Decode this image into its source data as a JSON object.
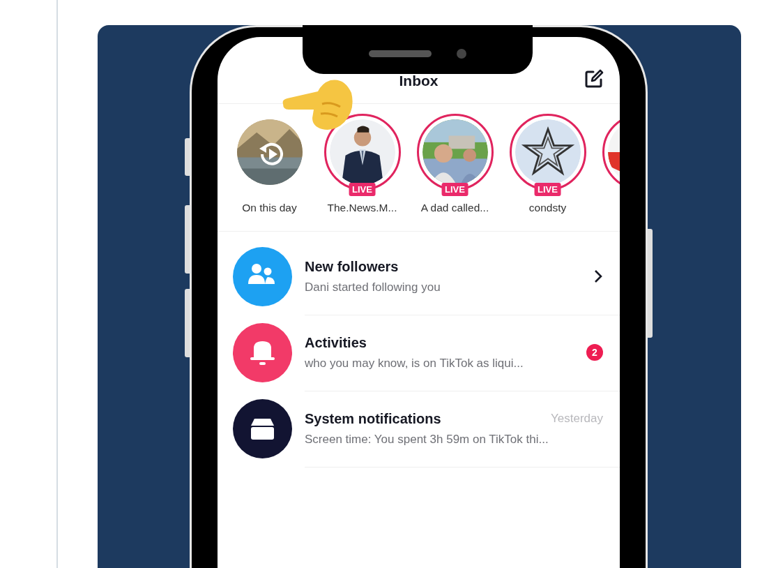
{
  "header": {
    "title": "Inbox"
  },
  "stories": [
    {
      "label": "On this day",
      "ring": false,
      "kind": "memory"
    },
    {
      "label": "The.News.M...",
      "ring": true,
      "badge": "LIVE",
      "kind": "person"
    },
    {
      "label": "A dad called...",
      "ring": true,
      "badge": "LIVE",
      "kind": "outdoor"
    },
    {
      "label": "condsty",
      "ring": true,
      "badge": "LIVE",
      "kind": "emblem"
    },
    {
      "ring": true,
      "kind": "partial"
    }
  ],
  "rows": [
    {
      "kind": "followers",
      "color": "#1da1f2",
      "title": "New followers",
      "subtitle": "Dani started following you",
      "chevron": true
    },
    {
      "kind": "activities",
      "color": "#f23a68",
      "title": "Activities",
      "subtitle": "who you may know, is on TikTok as liqui...",
      "badge": "2"
    },
    {
      "kind": "system",
      "color": "#121432",
      "title": "System notifications",
      "time": "Yesterday",
      "subtitle": "Screen time: You spent 3h 59m on TikTok thi..."
    }
  ]
}
